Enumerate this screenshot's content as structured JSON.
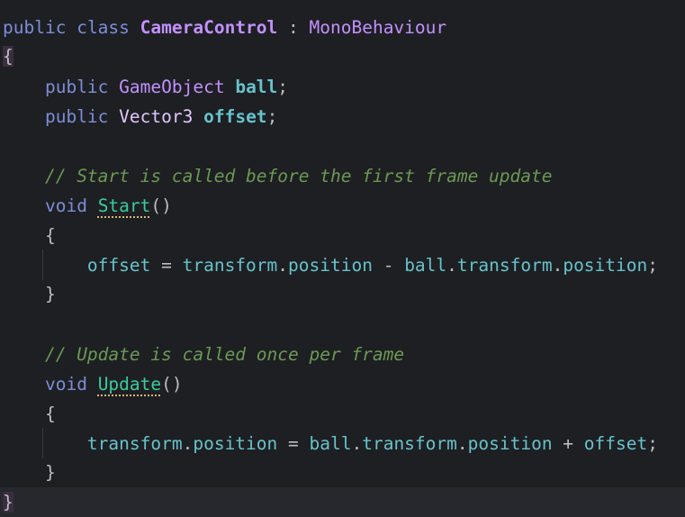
{
  "code": {
    "class_kw1": "public",
    "class_kw2": "class",
    "class_name": "CameraControl",
    "class_sep": " : ",
    "base_class": "MonoBehaviour",
    "open_brace": "{",
    "close_brace": "}",
    "field1": {
      "mod": "public",
      "type": "GameObject",
      "name": "ball",
      "end": ";"
    },
    "field2": {
      "mod": "public",
      "type": "Vector3",
      "name": "offset",
      "end": ";"
    },
    "comment1": "// Start is called before the first frame update",
    "start_method": {
      "ret": "void",
      "name": "Start",
      "parens": "()"
    },
    "start_body": {
      "lhs": "offset",
      "eq": " = ",
      "a": "transform",
      "dot1": ".",
      "b": "position",
      "minus": " - ",
      "c": "ball",
      "dot2": ".",
      "d": "transform",
      "dot3": ".",
      "e": "position",
      "end": ";"
    },
    "comment2": "// Update is called once per frame",
    "update_method": {
      "ret": "void",
      "name": "Update",
      "parens": "()"
    },
    "update_body": {
      "a": "transform",
      "dot1": ".",
      "b": "position",
      "eq": " = ",
      "c": "ball",
      "dot2": ".",
      "d": "transform",
      "dot3": ".",
      "e": "position",
      "plus": " + ",
      "f": "offset",
      "end": ";"
    },
    "inner_open": "{",
    "inner_close": "}"
  },
  "colors": {
    "background": "#1e1f22",
    "keyword": "#7c8dd8",
    "class": "#c191ff",
    "field": "#66c3cc",
    "method": "#39cc9b",
    "comment": "#6a9955",
    "text": "#bcbec4"
  }
}
